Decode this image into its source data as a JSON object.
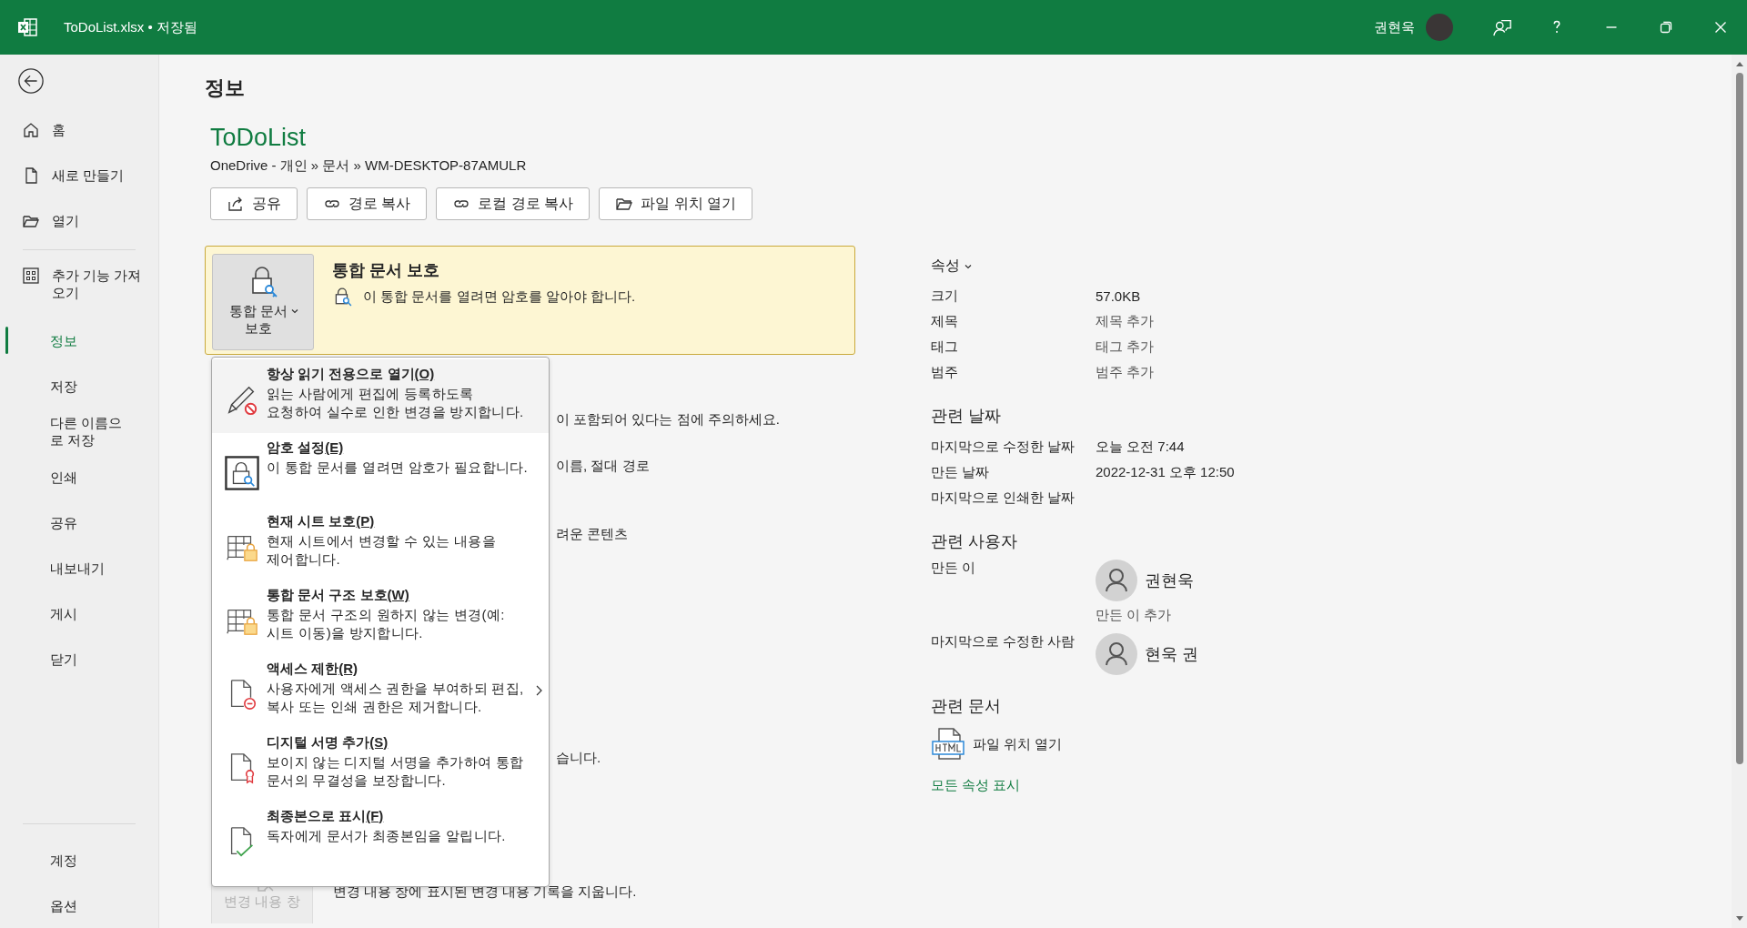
{
  "window": {
    "title": "ToDoList.xlsx • 저장됨",
    "user_name": "권현욱"
  },
  "sidebar": {
    "top_items": [
      {
        "label": "홈",
        "selected": false
      },
      {
        "label": "새로 만들기",
        "selected": false
      },
      {
        "label": "열기",
        "selected": false
      }
    ],
    "addin_item": {
      "label": "추가 기능 가져오기",
      "selected": false
    },
    "items": [
      {
        "label": "정보",
        "selected": true
      },
      {
        "label": "저장",
        "selected": false
      },
      {
        "label": "다른 이름으로 저장",
        "selected": false
      },
      {
        "label": "인쇄",
        "selected": false
      },
      {
        "label": "공유",
        "selected": false
      },
      {
        "label": "내보내기",
        "selected": false
      },
      {
        "label": "게시",
        "selected": false
      },
      {
        "label": "닫기",
        "selected": false
      }
    ],
    "bottom_items": [
      {
        "label": "계정",
        "selected": false
      },
      {
        "label": "옵션",
        "selected": false
      }
    ]
  },
  "page_title": "정보",
  "document": {
    "name": "ToDoList",
    "path": "OneDrive - 개인 » 문서 » WM-DESKTOP-87AMULR"
  },
  "actions": [
    {
      "label": "공유"
    },
    {
      "label": "경로 복사"
    },
    {
      "label": "로컬 경로 복사"
    },
    {
      "label": "파일 위치 열기"
    }
  ],
  "protect": {
    "button": "통합 문서 보호",
    "title": "통합 문서 보호",
    "message": "이 통합 문서를 열려면 암호를 알아야 합니다."
  },
  "covered_lines": [
    "이 포함되어 있다는 점에 주의하세요.",
    "이름, 절대 경로",
    "려운 콘텐츠",
    "습니다."
  ],
  "changes": {
    "button": "변경 내용 창",
    "description": "변경 내용 창에 표시된 변경 내용 기록을 지웁니다."
  },
  "protect_menu": [
    {
      "title": "항상 읽기 전용으로 열기",
      "mnemonic": "(O)",
      "description": "읽는 사람에게 편집에 등록하도록 요청하여 실수로 인한 변경을 방지합니다.",
      "highlighted": true,
      "has_submenu": false
    },
    {
      "title": "암호 설정",
      "mnemonic": "(E)",
      "description": "이 통합 문서를 열려면 암호가 필요합니다.",
      "highlighted": false,
      "has_submenu": false
    },
    {
      "title": "현재 시트 보호",
      "mnemonic": "(P)",
      "description": "현재 시트에서 변경할 수 있는 내용을 제어합니다.",
      "highlighted": false,
      "has_submenu": false
    },
    {
      "title": "통합 문서 구조 보호",
      "mnemonic": "(W)",
      "description": "통합 문서 구조의 원하지 않는 변경(예: 시트 이동)을 방지합니다.",
      "highlighted": false,
      "has_submenu": false
    },
    {
      "title": "액세스 제한",
      "mnemonic": "(R)",
      "description": "사용자에게 액세스 권한을 부여하되 편집, 복사 또는 인쇄 권한은 제거합니다.",
      "highlighted": false,
      "has_submenu": true
    },
    {
      "title": "디지털 서명 추가",
      "mnemonic": "(S)",
      "description": "보이지 않는 디지털 서명을 추가하여 통합 문서의 무결성을 보장합니다.",
      "highlighted": false,
      "has_submenu": false
    },
    {
      "title": "최종본으로 표시",
      "mnemonic": "(F)",
      "description": "독자에게 문서가 최종본임을 알립니다.",
      "highlighted": false,
      "has_submenu": false
    }
  ],
  "properties": {
    "heading": "속성",
    "rows": [
      {
        "label": "크기",
        "value": "57.0KB"
      },
      {
        "label": "제목",
        "placeholder": "제목 추가"
      },
      {
        "label": "태그",
        "placeholder": "태그 추가"
      },
      {
        "label": "범주",
        "placeholder": "범주 추가"
      }
    ]
  },
  "related_dates": {
    "heading": "관련 날짜",
    "rows": [
      {
        "label": "마지막으로 수정한 날짜",
        "value": "오늘 오전 7:44"
      },
      {
        "label": "만든 날짜",
        "value": "2022-12-31 오후 12:50"
      },
      {
        "label": "마지막으로 인쇄한 날짜"
      }
    ]
  },
  "related_people": {
    "heading": "관련 사용자",
    "author_label": "만든 이",
    "author": "권현욱",
    "add_author": "만든 이 추가",
    "modified_by_label": "마지막으로 수정한 사람",
    "modified_by": "현욱 권"
  },
  "related_documents": {
    "heading": "관련 문서",
    "link": "파일 위치 열기"
  },
  "show_all": "모든 속성 표시"
}
